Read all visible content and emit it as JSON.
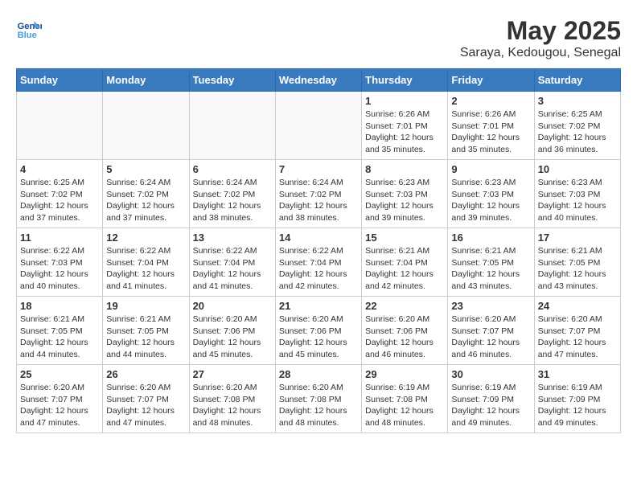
{
  "header": {
    "logo_line1": "General",
    "logo_line2": "Blue",
    "month_year": "May 2025",
    "location": "Saraya, Kedougou, Senegal"
  },
  "days_of_week": [
    "Sunday",
    "Monday",
    "Tuesday",
    "Wednesday",
    "Thursday",
    "Friday",
    "Saturday"
  ],
  "weeks": [
    [
      {
        "day": "",
        "info": ""
      },
      {
        "day": "",
        "info": ""
      },
      {
        "day": "",
        "info": ""
      },
      {
        "day": "",
        "info": ""
      },
      {
        "day": "1",
        "info": "Sunrise: 6:26 AM\nSunset: 7:01 PM\nDaylight: 12 hours\nand 35 minutes."
      },
      {
        "day": "2",
        "info": "Sunrise: 6:26 AM\nSunset: 7:01 PM\nDaylight: 12 hours\nand 35 minutes."
      },
      {
        "day": "3",
        "info": "Sunrise: 6:25 AM\nSunset: 7:02 PM\nDaylight: 12 hours\nand 36 minutes."
      }
    ],
    [
      {
        "day": "4",
        "info": "Sunrise: 6:25 AM\nSunset: 7:02 PM\nDaylight: 12 hours\nand 37 minutes."
      },
      {
        "day": "5",
        "info": "Sunrise: 6:24 AM\nSunset: 7:02 PM\nDaylight: 12 hours\nand 37 minutes."
      },
      {
        "day": "6",
        "info": "Sunrise: 6:24 AM\nSunset: 7:02 PM\nDaylight: 12 hours\nand 38 minutes."
      },
      {
        "day": "7",
        "info": "Sunrise: 6:24 AM\nSunset: 7:02 PM\nDaylight: 12 hours\nand 38 minutes."
      },
      {
        "day": "8",
        "info": "Sunrise: 6:23 AM\nSunset: 7:03 PM\nDaylight: 12 hours\nand 39 minutes."
      },
      {
        "day": "9",
        "info": "Sunrise: 6:23 AM\nSunset: 7:03 PM\nDaylight: 12 hours\nand 39 minutes."
      },
      {
        "day": "10",
        "info": "Sunrise: 6:23 AM\nSunset: 7:03 PM\nDaylight: 12 hours\nand 40 minutes."
      }
    ],
    [
      {
        "day": "11",
        "info": "Sunrise: 6:22 AM\nSunset: 7:03 PM\nDaylight: 12 hours\nand 40 minutes."
      },
      {
        "day": "12",
        "info": "Sunrise: 6:22 AM\nSunset: 7:04 PM\nDaylight: 12 hours\nand 41 minutes."
      },
      {
        "day": "13",
        "info": "Sunrise: 6:22 AM\nSunset: 7:04 PM\nDaylight: 12 hours\nand 41 minutes."
      },
      {
        "day": "14",
        "info": "Sunrise: 6:22 AM\nSunset: 7:04 PM\nDaylight: 12 hours\nand 42 minutes."
      },
      {
        "day": "15",
        "info": "Sunrise: 6:21 AM\nSunset: 7:04 PM\nDaylight: 12 hours\nand 42 minutes."
      },
      {
        "day": "16",
        "info": "Sunrise: 6:21 AM\nSunset: 7:05 PM\nDaylight: 12 hours\nand 43 minutes."
      },
      {
        "day": "17",
        "info": "Sunrise: 6:21 AM\nSunset: 7:05 PM\nDaylight: 12 hours\nand 43 minutes."
      }
    ],
    [
      {
        "day": "18",
        "info": "Sunrise: 6:21 AM\nSunset: 7:05 PM\nDaylight: 12 hours\nand 44 minutes."
      },
      {
        "day": "19",
        "info": "Sunrise: 6:21 AM\nSunset: 7:05 PM\nDaylight: 12 hours\nand 44 minutes."
      },
      {
        "day": "20",
        "info": "Sunrise: 6:20 AM\nSunset: 7:06 PM\nDaylight: 12 hours\nand 45 minutes."
      },
      {
        "day": "21",
        "info": "Sunrise: 6:20 AM\nSunset: 7:06 PM\nDaylight: 12 hours\nand 45 minutes."
      },
      {
        "day": "22",
        "info": "Sunrise: 6:20 AM\nSunset: 7:06 PM\nDaylight: 12 hours\nand 46 minutes."
      },
      {
        "day": "23",
        "info": "Sunrise: 6:20 AM\nSunset: 7:07 PM\nDaylight: 12 hours\nand 46 minutes."
      },
      {
        "day": "24",
        "info": "Sunrise: 6:20 AM\nSunset: 7:07 PM\nDaylight: 12 hours\nand 47 minutes."
      }
    ],
    [
      {
        "day": "25",
        "info": "Sunrise: 6:20 AM\nSunset: 7:07 PM\nDaylight: 12 hours\nand 47 minutes."
      },
      {
        "day": "26",
        "info": "Sunrise: 6:20 AM\nSunset: 7:07 PM\nDaylight: 12 hours\nand 47 minutes."
      },
      {
        "day": "27",
        "info": "Sunrise: 6:20 AM\nSunset: 7:08 PM\nDaylight: 12 hours\nand 48 minutes."
      },
      {
        "day": "28",
        "info": "Sunrise: 6:20 AM\nSunset: 7:08 PM\nDaylight: 12 hours\nand 48 minutes."
      },
      {
        "day": "29",
        "info": "Sunrise: 6:19 AM\nSunset: 7:08 PM\nDaylight: 12 hours\nand 48 minutes."
      },
      {
        "day": "30",
        "info": "Sunrise: 6:19 AM\nSunset: 7:09 PM\nDaylight: 12 hours\nand 49 minutes."
      },
      {
        "day": "31",
        "info": "Sunrise: 6:19 AM\nSunset: 7:09 PM\nDaylight: 12 hours\nand 49 minutes."
      }
    ]
  ]
}
